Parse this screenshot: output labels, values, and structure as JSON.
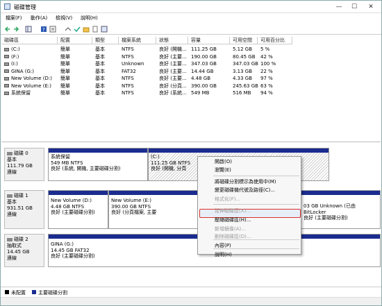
{
  "window": {
    "title": "磁碟管理",
    "controls": [
      "—",
      "☐",
      "✕"
    ]
  },
  "menu": [
    "檔案(F)",
    "動作(A)",
    "檢視(V)",
    "說明(H)"
  ],
  "table": {
    "headers": [
      "磁碟區",
      "配置",
      "類型",
      "檔案系統",
      "狀態",
      "容量",
      "可用空間",
      "可用百分比"
    ],
    "rows": [
      [
        "(C:)",
        "簡單",
        "基本",
        "NTFS",
        "良好 (開機...",
        "111.25 GB",
        "5.12 GB",
        "5 %"
      ],
      [
        "(F:)",
        "簡單",
        "基本",
        "NTFS",
        "良好 (主要...",
        "190.00 GB",
        "80.45 GB",
        "42 %"
      ],
      [
        "(I:)",
        "簡單",
        "基本",
        "Unknown",
        "良好 (主要...",
        "347.03 GB",
        "347.03 GB",
        "100 %"
      ],
      [
        "GINA (G:)",
        "簡單",
        "基本",
        "FAT32",
        "良好 (主要...",
        "14.44 GB",
        "3.13 GB",
        "22 %"
      ],
      [
        "New Volume (D:)",
        "簡單",
        "基本",
        "NTFS",
        "良好 (主要...",
        "4.48 GB",
        "4.33 GB",
        "97 %"
      ],
      [
        "New Volume (E:)",
        "簡單",
        "基本",
        "NTFS",
        "良好 (分頁...",
        "390.00 GB",
        "245.63 GB",
        "63 %"
      ],
      [
        "系統保留",
        "簡單",
        "基本",
        "NTFS",
        "良好 (系統...",
        "549 MB",
        "516 MB",
        "94 %"
      ]
    ]
  },
  "disks": [
    {
      "label": "磁碟 0",
      "type": "基本",
      "size": "111.79 GB",
      "status": "連線",
      "partitions": [
        {
          "name": "系統保留",
          "info": "549 MB NTFS",
          "status": "良好 (系統, 開機, 主要磁碟分割)"
        },
        {
          "name": "(C:)",
          "info": "111.25 GB NTFS",
          "status": "良好 (開機, 分頁"
        }
      ]
    },
    {
      "label": "磁碟 1",
      "type": "基本",
      "size": "931.51 GB",
      "status": "連線",
      "partitions": [
        {
          "name": "New Volume (D:)",
          "info": "4.48 GB NTFS",
          "status": "良好 (主要磁碟分割)"
        },
        {
          "name": "New Volume (E:)",
          "info": "390.00 GB NTFS",
          "status": "良好 (分頁檔案, 主要"
        },
        {
          "name": "",
          "info": "03 GB Unknown (已由 BitLocker",
          "status": "良好 (主要磁碟分割)"
        }
      ]
    },
    {
      "label": "磁碟 2",
      "type": "抽取式",
      "size": "14.45 GB",
      "status": "連線",
      "partitions": [
        {
          "name": "GINA (G:)",
          "info": "14.45 GB FAT32",
          "status": "良好 (主要磁碟分割)"
        }
      ]
    }
  ],
  "context_menu": {
    "items": [
      {
        "label": "開啟(O)",
        "enabled": true
      },
      {
        "label": "瀏覽(E)",
        "enabled": true
      },
      {
        "label": "將磁碟分割標示為使用中(M)",
        "enabled": true
      },
      {
        "label": "變更磁碟機代號及路徑(C)...",
        "enabled": true
      },
      {
        "label": "格式化(F)...",
        "enabled": false
      },
      {
        "label": "延伸磁碟區(X)...",
        "enabled": false
      },
      {
        "label": "壓縮磁碟區(H)...",
        "enabled": true
      },
      {
        "label": "新增鏡像(A)...",
        "enabled": false
      },
      {
        "label": "刪除磁碟區(D)...",
        "enabled": false
      },
      {
        "label": "內容(P)",
        "enabled": true
      },
      {
        "label": "說明(H)",
        "enabled": true
      }
    ]
  },
  "legend": [
    {
      "label": "未配置",
      "color": "#000000"
    },
    {
      "label": "主要磁碟分割",
      "color": "#1a2c8f"
    }
  ]
}
